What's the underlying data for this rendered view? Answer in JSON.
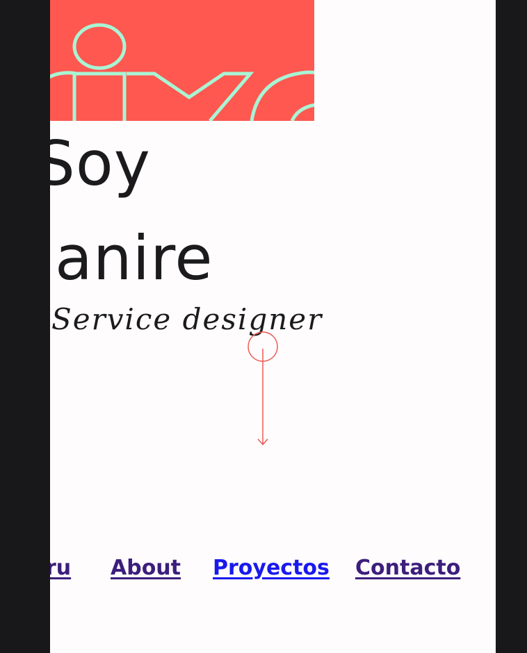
{
  "hero": {
    "logo_text": "pixo",
    "greeting": "Soy",
    "name": "Janire",
    "role": "Service designer"
  },
  "nav": {
    "items": [
      {
        "label": "ouru"
      },
      {
        "label": "About"
      },
      {
        "label": "Proyectos"
      },
      {
        "label": "Contacto"
      }
    ]
  },
  "colors": {
    "banner": "#fe5851",
    "logo_outline": "#a8f5d4",
    "text": "#1b1b1d",
    "link_visited": "#3c1e7c",
    "link": "#1919ee",
    "accent": "#ec5a56",
    "frame": "#18181b"
  }
}
